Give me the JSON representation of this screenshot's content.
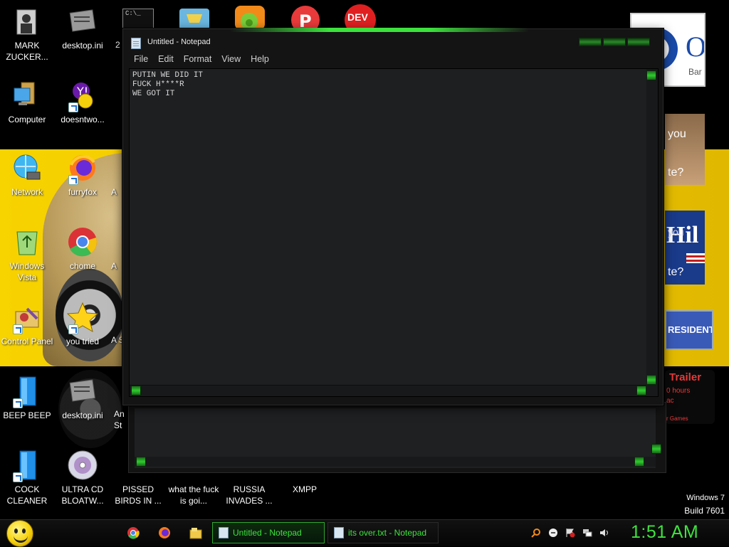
{
  "desktop": {
    "icons": [
      {
        "id": "mark-zuckerberg",
        "label": "MARK ZUCKER..."
      },
      {
        "id": "desktop-ini",
        "label": "desktop.ini"
      },
      {
        "id": "computer",
        "label": "Computer"
      },
      {
        "id": "doesntwork",
        "label": "doesntwo..."
      },
      {
        "id": "network",
        "label": "Network"
      },
      {
        "id": "furryfox",
        "label": "furryfox"
      },
      {
        "id": "windows-vista",
        "label": "Windows Vista"
      },
      {
        "id": "chome",
        "label": "chome"
      },
      {
        "id": "control-panel",
        "label": "Control Panel"
      },
      {
        "id": "you-tried",
        "label": "you tried"
      },
      {
        "id": "beep-beep",
        "label": "BEEP BEEP"
      },
      {
        "id": "desktop-ini-2",
        "label": "desktop.ini"
      },
      {
        "id": "cock-cleaner",
        "label": "COCK CLEANER"
      },
      {
        "id": "ultra-cd",
        "label": "ULTRA CD BLOATW..."
      },
      {
        "id": "pissed-birds",
        "label": "PISSED BIRDS IN ..."
      },
      {
        "id": "what-the-fuck",
        "label": "what the fuck is goi..."
      },
      {
        "id": "russia-invades",
        "label": "RUSSIA INVADES ..."
      },
      {
        "id": "xmpp",
        "label": "XMPP"
      }
    ],
    "partial_labels": [
      "2",
      "A",
      "A",
      "A",
      "A S",
      "An St"
    ],
    "ads": {
      "bar": "Bar",
      "you": "you",
      "te": "te?",
      "hil": "Hil",
      "you2": "you",
      "te2": "te?",
      "resident": "RESIDENT",
      "trailer": "Trailer",
      "hours": "0 hours",
      "ac": "ac",
      "games": "r Games",
      "dev": "DEV"
    },
    "watermark": {
      "os": "Windows 7",
      "build": "Build 7601"
    }
  },
  "notepad": {
    "title": "Untitled - Notepad",
    "menu": [
      "File",
      "Edit",
      "Format",
      "View",
      "Help"
    ],
    "content": "PUTIN WE DID IT\nFUCK H****R\nWE GOT IT"
  },
  "taskbar": {
    "tasks": [
      {
        "label": "Untitled - Notepad",
        "active": true
      },
      {
        "label": "its over.txt - Notepad",
        "active": false
      }
    ],
    "clock": "1:51 AM"
  },
  "colors": {
    "accent_green": "#3fe23f",
    "wallpaper_yellow": "#f2c800",
    "window_bg": "#141414"
  }
}
